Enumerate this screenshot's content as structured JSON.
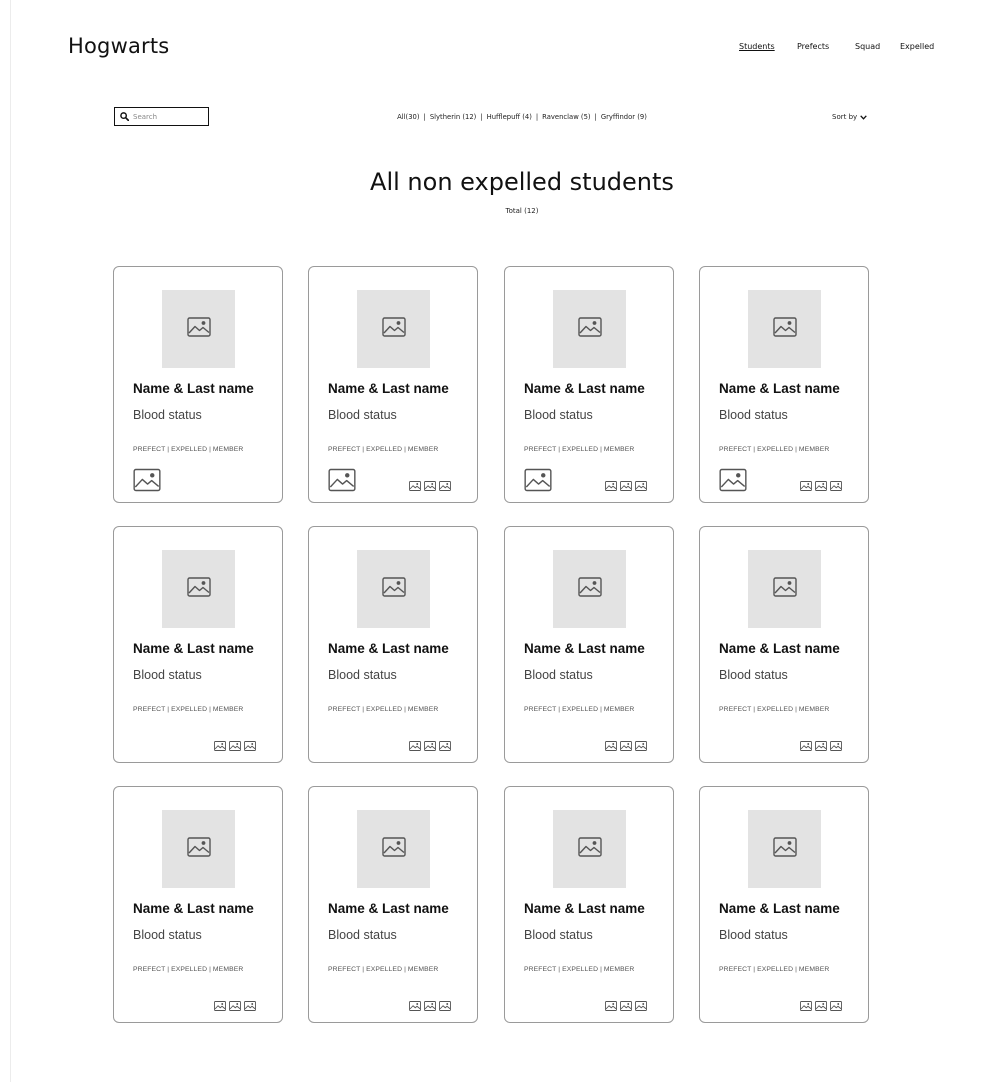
{
  "header": {
    "logo": "Hogwarts",
    "nav": [
      {
        "label": "Students",
        "active": true
      },
      {
        "label": "Prefects",
        "active": false
      },
      {
        "label": "Squad",
        "active": false
      },
      {
        "label": "Expelled",
        "active": false
      }
    ]
  },
  "toolbar": {
    "search_placeholder": "Search",
    "filters": [
      "All(30)",
      "Slytherin (12)",
      "Hufflepuff (4)",
      "Ravenclaw (5)",
      "Gryffindor (9)"
    ],
    "filter_separator": "|",
    "sort_label": "Sort by"
  },
  "main": {
    "title": "All non expelled students",
    "subtitle": "Total (12)"
  },
  "cards": [
    {
      "name": "Name & Last name",
      "blood_status": "Blood status",
      "roles": "PREFECT | EXPELLED | MEMBER",
      "crest": true,
      "badges": 0
    },
    {
      "name": "Name & Last name",
      "blood_status": "Blood status",
      "roles": "PREFECT | EXPELLED | MEMBER",
      "crest": true,
      "badges": 3
    },
    {
      "name": "Name & Last name",
      "blood_status": "Blood status",
      "roles": "PREFECT | EXPELLED | MEMBER",
      "crest": true,
      "badges": 3
    },
    {
      "name": "Name & Last name",
      "blood_status": "Blood status",
      "roles": "PREFECT | EXPELLED | MEMBER",
      "crest": true,
      "badges": 3
    },
    {
      "name": "Name & Last name",
      "blood_status": "Blood status",
      "roles": "PREFECT | EXPELLED | MEMBER",
      "crest": false,
      "badges": 3
    },
    {
      "name": "Name & Last name",
      "blood_status": "Blood status",
      "roles": "PREFECT | EXPELLED | MEMBER",
      "crest": false,
      "badges": 3
    },
    {
      "name": "Name & Last name",
      "blood_status": "Blood status",
      "roles": "PREFECT | EXPELLED | MEMBER",
      "crest": false,
      "badges": 3
    },
    {
      "name": "Name & Last name",
      "blood_status": "Blood status",
      "roles": "PREFECT | EXPELLED | MEMBER",
      "crest": false,
      "badges": 3
    },
    {
      "name": "Name & Last name",
      "blood_status": "Blood status",
      "roles": "PREFECT | EXPELLED | MEMBER",
      "crest": false,
      "badges": 3
    },
    {
      "name": "Name & Last name",
      "blood_status": "Blood status",
      "roles": "PREFECT | EXPELLED | MEMBER",
      "crest": false,
      "badges": 3
    },
    {
      "name": "Name & Last name",
      "blood_status": "Blood status",
      "roles": "PREFECT | EXPELLED | MEMBER",
      "crest": false,
      "badges": 3
    },
    {
      "name": "Name & Last name",
      "blood_status": "Blood status",
      "roles": "PREFECT | EXPELLED | MEMBER",
      "crest": false,
      "badges": 3
    }
  ],
  "icons": {
    "search": "search-icon",
    "sort": "chevron-down-icon",
    "photo": "image-placeholder-icon",
    "crest": "image-placeholder-icon",
    "badge": "image-placeholder-icon"
  }
}
